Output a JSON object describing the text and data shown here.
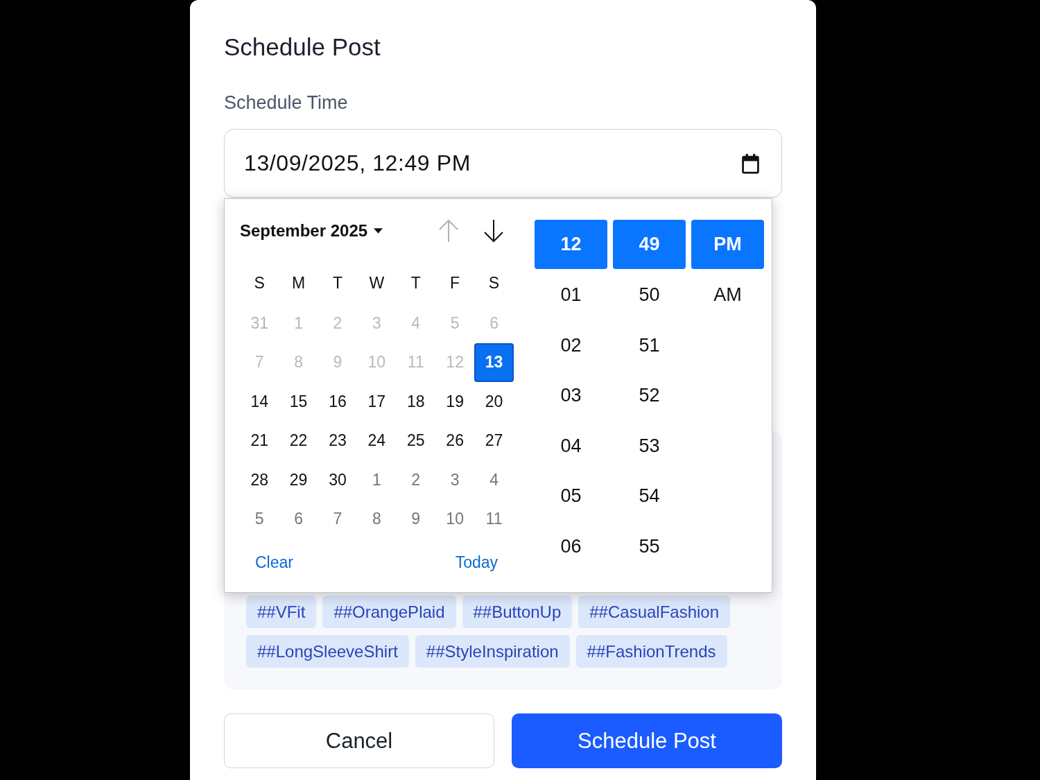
{
  "dialog": {
    "title": "Schedule Post"
  },
  "schedule_time": {
    "label": "Schedule Time",
    "value": "13/09/2025, 12:49 PM"
  },
  "date_picker": {
    "month_label": "September 2025",
    "nav": [
      {
        "kind": "up",
        "disabled": true
      },
      {
        "kind": "down",
        "disabled": false
      }
    ],
    "weekdays": [
      "S",
      "M",
      "T",
      "W",
      "T",
      "F",
      "S"
    ],
    "days": [
      {
        "day": "31",
        "outside": true,
        "disabled": true,
        "selected": false
      },
      {
        "day": "1",
        "outside": false,
        "disabled": true,
        "selected": false
      },
      {
        "day": "2",
        "outside": false,
        "disabled": true,
        "selected": false
      },
      {
        "day": "3",
        "outside": false,
        "disabled": true,
        "selected": false
      },
      {
        "day": "4",
        "outside": false,
        "disabled": true,
        "selected": false
      },
      {
        "day": "5",
        "outside": false,
        "disabled": true,
        "selected": false
      },
      {
        "day": "6",
        "outside": false,
        "disabled": true,
        "selected": false
      },
      {
        "day": "7",
        "outside": false,
        "disabled": true,
        "selected": false
      },
      {
        "day": "8",
        "outside": false,
        "disabled": true,
        "selected": false
      },
      {
        "day": "9",
        "outside": false,
        "disabled": true,
        "selected": false
      },
      {
        "day": "10",
        "outside": false,
        "disabled": true,
        "selected": false
      },
      {
        "day": "11",
        "outside": false,
        "disabled": true,
        "selected": false
      },
      {
        "day": "12",
        "outside": false,
        "disabled": true,
        "selected": false
      },
      {
        "day": "13",
        "outside": false,
        "disabled": false,
        "selected": true
      },
      {
        "day": "14",
        "outside": false,
        "disabled": false,
        "selected": false
      },
      {
        "day": "15",
        "outside": false,
        "disabled": false,
        "selected": false
      },
      {
        "day": "16",
        "outside": false,
        "disabled": false,
        "selected": false
      },
      {
        "day": "17",
        "outside": false,
        "disabled": false,
        "selected": false
      },
      {
        "day": "18",
        "outside": false,
        "disabled": false,
        "selected": false
      },
      {
        "day": "19",
        "outside": false,
        "disabled": false,
        "selected": false
      },
      {
        "day": "20",
        "outside": false,
        "disabled": false,
        "selected": false
      },
      {
        "day": "21",
        "outside": false,
        "disabled": false,
        "selected": false
      },
      {
        "day": "22",
        "outside": false,
        "disabled": false,
        "selected": false
      },
      {
        "day": "23",
        "outside": false,
        "disabled": false,
        "selected": false
      },
      {
        "day": "24",
        "outside": false,
        "disabled": false,
        "selected": false
      },
      {
        "day": "25",
        "outside": false,
        "disabled": false,
        "selected": false
      },
      {
        "day": "26",
        "outside": false,
        "disabled": false,
        "selected": false
      },
      {
        "day": "27",
        "outside": false,
        "disabled": false,
        "selected": false
      },
      {
        "day": "28",
        "outside": false,
        "disabled": false,
        "selected": false
      },
      {
        "day": "29",
        "outside": false,
        "disabled": false,
        "selected": false
      },
      {
        "day": "30",
        "outside": false,
        "disabled": false,
        "selected": false
      },
      {
        "day": "1",
        "outside": true,
        "disabled": false,
        "selected": false
      },
      {
        "day": "2",
        "outside": true,
        "disabled": false,
        "selected": false
      },
      {
        "day": "3",
        "outside": true,
        "disabled": false,
        "selected": false
      },
      {
        "day": "4",
        "outside": true,
        "disabled": false,
        "selected": false
      },
      {
        "day": "5",
        "outside": true,
        "disabled": false,
        "selected": false
      },
      {
        "day": "6",
        "outside": true,
        "disabled": false,
        "selected": false
      },
      {
        "day": "7",
        "outside": true,
        "disabled": false,
        "selected": false
      },
      {
        "day": "8",
        "outside": true,
        "disabled": false,
        "selected": false
      },
      {
        "day": "9",
        "outside": true,
        "disabled": false,
        "selected": false
      },
      {
        "day": "10",
        "outside": true,
        "disabled": false,
        "selected": false
      },
      {
        "day": "11",
        "outside": true,
        "disabled": false,
        "selected": false
      }
    ],
    "footer": {
      "clear": "Clear",
      "today": "Today"
    }
  },
  "time_picker": {
    "columns": [
      {
        "options": [
          {
            "label": "12",
            "selected": true
          },
          {
            "label": "01",
            "selected": false
          },
          {
            "label": "02",
            "selected": false
          },
          {
            "label": "03",
            "selected": false
          },
          {
            "label": "04",
            "selected": false
          },
          {
            "label": "05",
            "selected": false
          },
          {
            "label": "06",
            "selected": false
          }
        ]
      },
      {
        "options": [
          {
            "label": "49",
            "selected": true
          },
          {
            "label": "50",
            "selected": false
          },
          {
            "label": "51",
            "selected": false
          },
          {
            "label": "52",
            "selected": false
          },
          {
            "label": "53",
            "selected": false
          },
          {
            "label": "54",
            "selected": false
          },
          {
            "label": "55",
            "selected": false
          }
        ]
      },
      {
        "options": [
          {
            "label": "PM",
            "selected": true
          },
          {
            "label": "AM",
            "selected": false
          }
        ]
      }
    ]
  },
  "hashtags": [
    "##VFit",
    "##OrangePlaid",
    "##ButtonUp",
    "##CasualFashion",
    "##LongSleeveShirt",
    "##StyleInspiration",
    "##FashionTrends"
  ],
  "actions": {
    "cancel": "Cancel",
    "submit": "Schedule Post"
  }
}
